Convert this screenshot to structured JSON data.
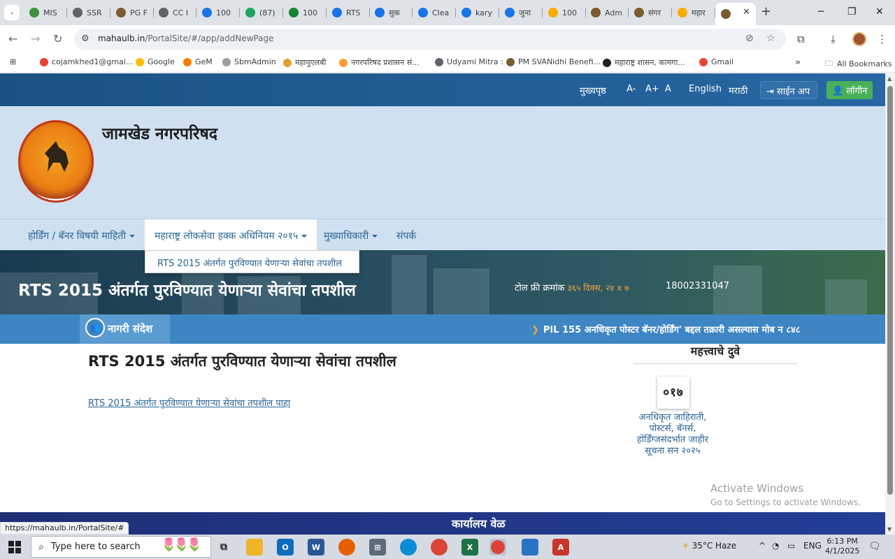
{
  "browser": {
    "tabs": [
      {
        "label": "MIS",
        "fav_color": "#3f8f3f"
      },
      {
        "label": "SSR",
        "fav_color": "#5f6368"
      },
      {
        "label": "PG F",
        "fav_color": "#7a5c2e"
      },
      {
        "label": "CC I",
        "fav_color": "#5f6368"
      },
      {
        "label": "100",
        "fav_color": "#1a73e8"
      },
      {
        "label": "(87)",
        "fav_color": "#1ea362"
      },
      {
        "label": "100",
        "fav_color": "#188038"
      },
      {
        "label": "RTS",
        "fav_color": "#1a73e8"
      },
      {
        "label": "सुक",
        "fav_color": "#1a73e8"
      },
      {
        "label": "Clea",
        "fav_color": "#1a73e8"
      },
      {
        "label": "kary",
        "fav_color": "#1a73e8"
      },
      {
        "label": "जुना",
        "fav_color": "#1a73e8"
      },
      {
        "label": "100",
        "fav_color": "#f9ab00"
      },
      {
        "label": "Adm",
        "fav_color": "#7a5c2e"
      },
      {
        "label": "संगर",
        "fav_color": "#7a5c2e"
      },
      {
        "label": "महार",
        "fav_color": "#f9ab00"
      }
    ],
    "active_tab_close": "✕",
    "new_tab": "+",
    "url_host": "mahaulb.in",
    "url_path": "/PortalSite/#/app/addNewPage",
    "bookmarks": [
      {
        "label": "cojamkhed1@gmai...",
        "icon_color": "#ea4335"
      },
      {
        "label": "Google",
        "icon_color": "#fbbc04"
      },
      {
        "label": "GeM",
        "icon_color": "#f57c00"
      },
      {
        "label": "SbmAdmin",
        "icon_color": "#9e9e9e"
      },
      {
        "label": "महायुएलबी",
        "icon_color": "#e0a030"
      },
      {
        "label": "नगरपरिषद प्रशासन सं...",
        "icon_color": "#ff9933"
      },
      {
        "label": "Udyami Mitra :",
        "icon_color": "#5f6368"
      },
      {
        "label": "PM SVANidhi Benefi...",
        "icon_color": "#7a5c2e"
      },
      {
        "label": "महाराष्ट्र शासन, कामगा...",
        "icon_color": "#202124"
      },
      {
        "label": "Gmail",
        "icon_color": "#ea4335"
      }
    ],
    "bookmarks_overflow": "»",
    "all_bookmarks": "All Bookmarks"
  },
  "topbar": {
    "home": "मुख्यपृष्ठ",
    "font_decrease": "A-",
    "font_increase": "A+",
    "font_normal": "A",
    "lang_english": "English",
    "lang_marathi": "मराठी",
    "signup": "साईन अप",
    "login": "लॉगीन"
  },
  "header": {
    "site_title": "जामखेड नगरपरिषद"
  },
  "menu": {
    "items": [
      {
        "label": "होर्डिंग / बॅनर विषयी माहिती"
      },
      {
        "label": "महाराष्ट्र लोकसेवा हक्क अधिनियम २०१५"
      },
      {
        "label": "मुख्याधिकारी"
      },
      {
        "label": "संपर्क"
      }
    ],
    "dropdown_item": "RTS 2015 अंतर्गत पुरविण्यात येणाऱ्या सेवांचा तपशील"
  },
  "banner": {
    "title": "RTS 2015 अंतर्गत पुरविण्यात येणाऱ्या सेवांचा तपशील",
    "tollfree_label": "टोल फ्री क्रमांक",
    "tollfree_hours": "३६५ दिवस, २४ x ७",
    "tollfree_number": "18002331047"
  },
  "ticker": {
    "badge": "नागरी संदेश",
    "text": "PIL 155 अनधिकृत पोस्टर बॅनर/होर्डिंग' बद्दल तक्रारी असल्यास मोब न ८४८"
  },
  "content": {
    "title": "RTS 2015 अंतर्गत पुरविण्यात येणाऱ्या सेवांचा तपशील",
    "link": "RTS 2015 अंतर्गत पुरविण्यात येणाऱ्या सेवांचा तपशील पाहा"
  },
  "sidebar": {
    "heading": "महत्त्वाचे दुवे",
    "thumb_text": "०१७",
    "link": "अनधिकृत जाहिराती, पोस्टर्स, बॅनर्स, होर्डिंग्जसंदर्भात जाहीर सूचना सन २०२५"
  },
  "footer": {
    "office_hours": "कार्यालय वेळ"
  },
  "status_url": "https://mahaulb.in/PortalSite/#",
  "windows_activation": {
    "line1": "Activate Windows",
    "line2": "Go to Settings to activate Windows."
  },
  "taskbar": {
    "search_placeholder": "Type here to search",
    "weather": "35°C  Haze",
    "lang": "ENG",
    "time": "6:13 PM",
    "date": "4/1/2025"
  },
  "colors": {
    "topbar": "#1f5c8f",
    "header_bg": "#cfe1f0",
    "link": "#2a6496",
    "login_green": "#49b05a",
    "ticker_blue": "#3d86c3",
    "footer_navy": "#1e3a8a",
    "tollfree_orange": "#f4a640"
  }
}
